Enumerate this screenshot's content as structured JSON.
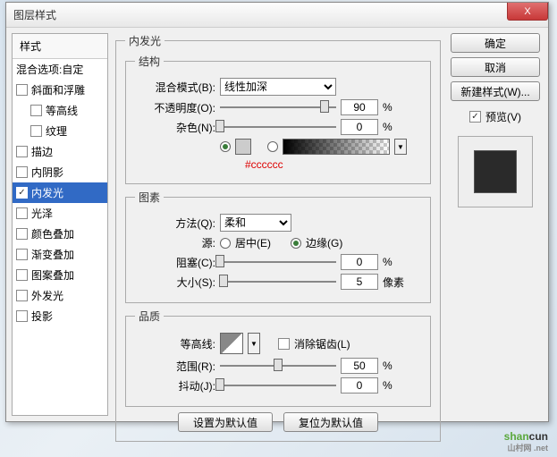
{
  "title": "图层样式",
  "close": "X",
  "sidebar": {
    "header": "样式",
    "blend_opts": "混合选项:自定",
    "items": [
      {
        "label": "斜面和浮雕",
        "checked": false,
        "sub": false
      },
      {
        "label": "等高线",
        "checked": false,
        "sub": true
      },
      {
        "label": "纹理",
        "checked": false,
        "sub": true
      },
      {
        "label": "描边",
        "checked": false,
        "sub": false
      },
      {
        "label": "内阴影",
        "checked": false,
        "sub": false
      },
      {
        "label": "内发光",
        "checked": true,
        "sub": false,
        "selected": true
      },
      {
        "label": "光泽",
        "checked": false,
        "sub": false
      },
      {
        "label": "颜色叠加",
        "checked": false,
        "sub": false
      },
      {
        "label": "渐变叠加",
        "checked": false,
        "sub": false
      },
      {
        "label": "图案叠加",
        "checked": false,
        "sub": false
      },
      {
        "label": "外发光",
        "checked": false,
        "sub": false
      },
      {
        "label": "投影",
        "checked": false,
        "sub": false
      }
    ]
  },
  "main": {
    "title": "内发光",
    "structure": {
      "legend": "结构",
      "blendmode_label": "混合模式(B):",
      "blendmode_value": "线性加深",
      "opacity_label": "不透明度(O):",
      "opacity_value": "90",
      "pct": "%",
      "noise_label": "杂色(N):",
      "noise_value": "0",
      "hex_note": "#cccccc"
    },
    "graphic": {
      "legend": "图素",
      "method_label": "方法(Q):",
      "method_value": "柔和",
      "source_label": "源:",
      "source_center": "居中(E)",
      "source_edge": "边缘(G)",
      "choke_label": "阻塞(C):",
      "choke_value": "0",
      "pct": "%",
      "size_label": "大小(S):",
      "size_value": "5",
      "px": "像素"
    },
    "quality": {
      "legend": "品质",
      "contour_label": "等高线:",
      "antialias": "消除锯齿(L)",
      "range_label": "范围(R):",
      "range_value": "50",
      "jitter_label": "抖动(J):",
      "jitter_value": "0",
      "pct": "%"
    },
    "btn_default": "设置为默认值",
    "btn_reset": "复位为默认值"
  },
  "right": {
    "ok": "确定",
    "cancel": "取消",
    "newstyle": "新建样式(W)...",
    "preview": "预览(V)"
  },
  "watermark": {
    "p1": "shan",
    "p2": "cun",
    "tag": "山村网 .net"
  }
}
